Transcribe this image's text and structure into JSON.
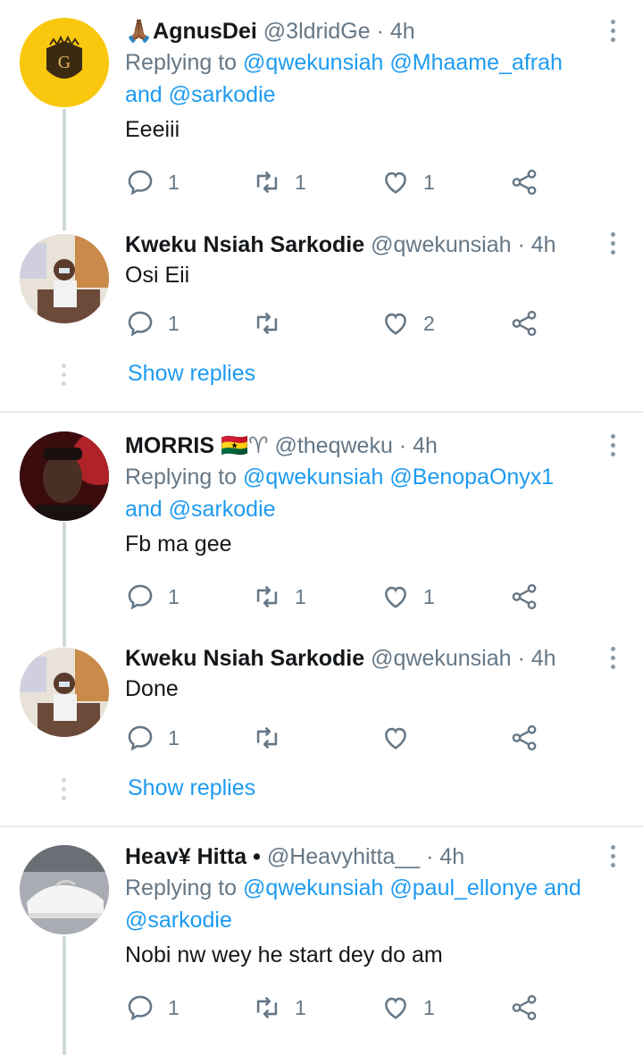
{
  "tweets": [
    {
      "name": "AgnusDei",
      "name_prefix_emoji": "🙏🏾",
      "handle": "@3ldridGe",
      "time": "· 4h",
      "replying_prefix": "Replying to",
      "replying_to": "@qwekunsiah @Mhaame_afrah",
      "replying_and": "and",
      "replying_last": "@sarkodie",
      "text": "Eeeiii",
      "reply_count": "1",
      "retweet_count": "1",
      "like_count": "1"
    },
    {
      "name": "Kweku Nsiah Sarkodie",
      "handle": "@qwekunsiah",
      "time": "· 4h",
      "text": "Osi Eii",
      "reply_count": "1",
      "retweet_count": "",
      "like_count": "2",
      "show_replies": "Show replies"
    },
    {
      "name": "MORRIS",
      "name_suffix_emoji": "🇬🇭♈",
      "handle": "@theqweku",
      "time": "· 4h",
      "replying_prefix": "Replying to",
      "replying_to": "@qwekunsiah @BenopaOnyx1",
      "replying_and": "and",
      "replying_last": "@sarkodie",
      "text": "Fb ma gee",
      "reply_count": "1",
      "retweet_count": "1",
      "like_count": "1"
    },
    {
      "name": "Kweku Nsiah Sarkodie",
      "handle": "@qwekunsiah",
      "time": "· 4h",
      "text": "Done",
      "reply_count": "1",
      "retweet_count": "",
      "like_count": "",
      "show_replies": "Show replies"
    },
    {
      "name": "Heav¥ Hitta •",
      "handle": "@Heavyhitta__",
      "time": "· 4h",
      "replying_prefix": "Replying to",
      "replying_to": "@qwekunsiah @paul_ellonye",
      "replying_and": "and",
      "replying_last": "@sarkodie",
      "text": "Nobi nw wey he start dey do am",
      "reply_count": "1",
      "retweet_count": "1",
      "like_count": "1"
    }
  ],
  "colors": {
    "link": "#1d9bf0",
    "muted": "#657786",
    "line": "#cfd9de"
  },
  "icons": [
    "reply-icon",
    "retweet-icon",
    "like-icon",
    "share-icon",
    "more-options-icon"
  ]
}
